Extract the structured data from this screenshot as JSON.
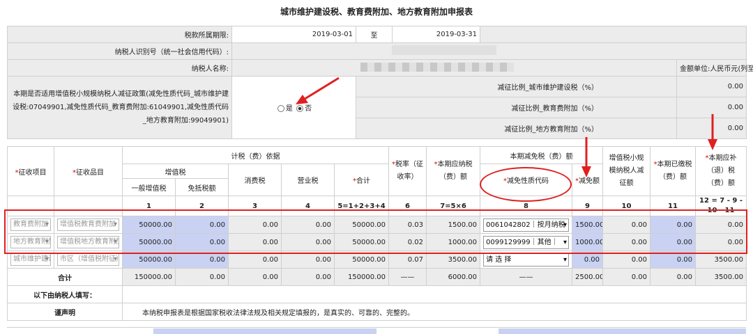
{
  "title": "城市维护建设税、教育费附加、地方教育附加申报表",
  "info": {
    "period_label": "税款所属期限:",
    "period_start": "2019-03-01",
    "period_to": "至",
    "period_end": "2019-03-31",
    "taxpayer_id_label": "纳税人识别号（统一社会信用代码）:",
    "taxpayer_name_label": "纳税人名称:",
    "unit_label": "金额单位:人民币元(列至角分)",
    "policy_text": "本期是否适用增值税小规模纳税人减征政策(减免性质代码_城市维护建设税:07049901,减免性质代码_教育费附加:61049901,减免性质代码_地方教育附加:99049901)",
    "radio_yes": "是",
    "radio_no": "否",
    "ratios": [
      {
        "label": "减征比例_城市维护建设税（%）",
        "value": "0.00"
      },
      {
        "label": "减征比例_教育费附加（%）",
        "value": "0.00"
      },
      {
        "label": "减征比例_地方教育附加（%）",
        "value": "0.00"
      }
    ]
  },
  "headers": {
    "item": "征收项目",
    "subitem": "征收品目",
    "basis": "计税（费）依据",
    "vat": "增值税",
    "vat_general": "一般增值税",
    "vat_exempt": "免抵税额",
    "consumption": "消费税",
    "business": "营业税",
    "sum": "合计",
    "rate": "税率（征收率）",
    "payable": "本期应纳税（费）额",
    "relief": "本期减免税（费）额",
    "relief_code": "减免性质代码",
    "relief_amount": "减免额",
    "small_scale": "增值税小规模纳税人减征额",
    "paid": "本期已缴税（费）额",
    "due": "本期应补（退）税（费）额",
    "col_numbers": [
      "1",
      "2",
      "3",
      "4",
      "5=1+2+3+4",
      "6",
      "7=5×6",
      "8",
      "9",
      "10",
      "11",
      "12 = 7 - 9 - 10 - 11"
    ]
  },
  "rows": [
    {
      "item": "教育费附加",
      "subitem": "增值税教育费附加",
      "vat": "50000.00",
      "exempt": "0.00",
      "consumption": "0.00",
      "business": "0.00",
      "sum": "50000.00",
      "rate": "0.03",
      "payable": "1500.00",
      "code": "0061042802｜按月纳税",
      "relief": "1500.00",
      "small": "0.00",
      "paid": "0.00",
      "due": "0.00"
    },
    {
      "item": "地方教育附加",
      "subitem": "增值税地方教育附加",
      "vat": "50000.00",
      "exempt": "0.00",
      "consumption": "0.00",
      "business": "0.00",
      "sum": "50000.00",
      "rate": "0.02",
      "payable": "1000.00",
      "code": "0099129999｜其他｜",
      "relief": "1000.00",
      "small": "0.00",
      "paid": "0.00",
      "due": "0.00"
    },
    {
      "item": "城市维护建设税",
      "subitem": "市区（增值税附征）",
      "vat": "50000.00",
      "exempt": "0.00",
      "consumption": "0.00",
      "business": "0.00",
      "sum": "50000.00",
      "rate": "0.07",
      "payable": "3500.00",
      "code": "请 选 择",
      "relief": "0.00",
      "small": "0.00",
      "paid": "0.00",
      "due": "3500.00"
    }
  ],
  "total": {
    "label": "合计",
    "vat": "150000.00",
    "exempt": "0.00",
    "consumption": "0.00",
    "business": "0.00",
    "sum": "150000.00",
    "rate": "——",
    "payable": "6000.00",
    "code": "——",
    "relief": "2500.00",
    "small": "0.00",
    "paid": "0.00",
    "due": "3500.00"
  },
  "footer": {
    "fill_label": "以下由纳税人填写：",
    "declaration_label": "谨声明",
    "declaration_text": "本纳税申报表是根据国家税收法律法规及相关规定填报的，是真实的、可靠的、完整的。"
  },
  "colors": {
    "accent_red": "#e02020",
    "input_blue": "#c9d2f2",
    "readonly_gray": "#ececec"
  }
}
